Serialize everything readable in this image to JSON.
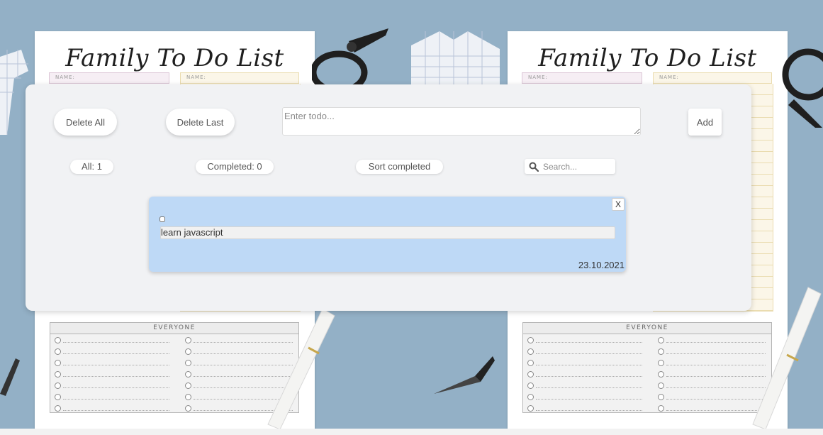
{
  "background": {
    "left_sheet": {
      "title": "Family To Do List",
      "name_label_1": "NAME:",
      "name_label_2": "NAME:",
      "section_label": "EVERYONE"
    },
    "right_sheet": {
      "title": "Family To Do List",
      "name_label_1": "NAME:",
      "name_label_2": "NAME:",
      "section_label": "EVERYONE"
    }
  },
  "toolbar": {
    "delete_all_label": "Delete All",
    "delete_last_label": "Delete Last",
    "input_placeholder": "Enter todo...",
    "input_value": "",
    "add_label": "Add"
  },
  "filters": {
    "all_label": "All: 1",
    "completed_label": "Completed: 0",
    "sort_label": "Sort completed",
    "search_placeholder": "Search...",
    "search_icon": "search-icon"
  },
  "todos": [
    {
      "text": "learn javascript",
      "date": "23.10.2021",
      "completed": false,
      "close_label": "X"
    }
  ],
  "colors": {
    "background": "#93b0c6",
    "card": "#f1f2f4",
    "todo_card": "#bed9f6"
  }
}
